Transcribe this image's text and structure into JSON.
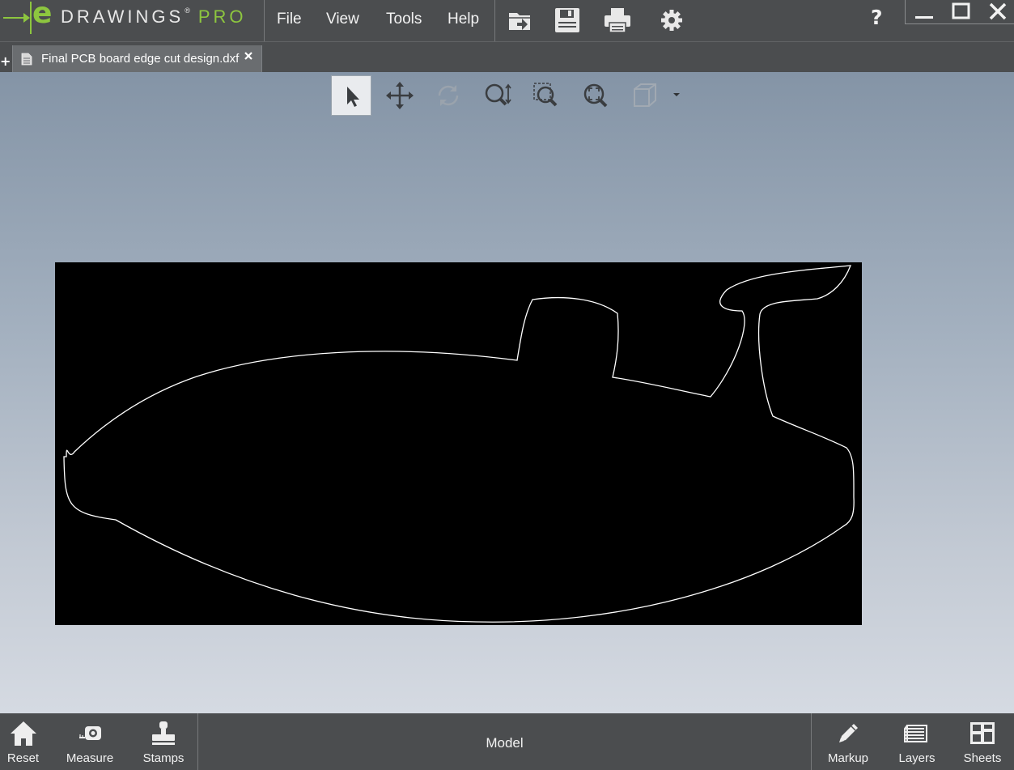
{
  "app": {
    "logo_letter": "e",
    "logo_name": "DRAWINGS",
    "logo_reg": "®",
    "logo_pro": "PRO"
  },
  "menu": {
    "file": "File",
    "view": "View",
    "tools": "Tools",
    "help": "Help"
  },
  "toolbar_icons": [
    "open-icon",
    "save-icon",
    "print-icon",
    "settings-icon"
  ],
  "help_label": "?",
  "window_controls": [
    "minimize-icon",
    "maximize-icon",
    "close-icon"
  ],
  "tabs": {
    "new_tab": "+",
    "active": {
      "title": "Final PCB board edge cut design.dxf"
    }
  },
  "view_tools": [
    "select-icon",
    "pan-icon",
    "rotate-icon",
    "zoom-icon",
    "zoom-to-area-icon",
    "zoom-to-fit-icon",
    "view-orientation-icon"
  ],
  "bottom": {
    "reset": "Reset",
    "measure": "Measure",
    "stamps": "Stamps",
    "model": "Model",
    "markup": "Markup",
    "layers": "Layers",
    "sheets": "Sheets"
  },
  "colors": {
    "chrome": "#4b4d4f",
    "accent": "#8dc63f",
    "drawing_background": "#000000",
    "drawing_line": "#ffffff"
  }
}
